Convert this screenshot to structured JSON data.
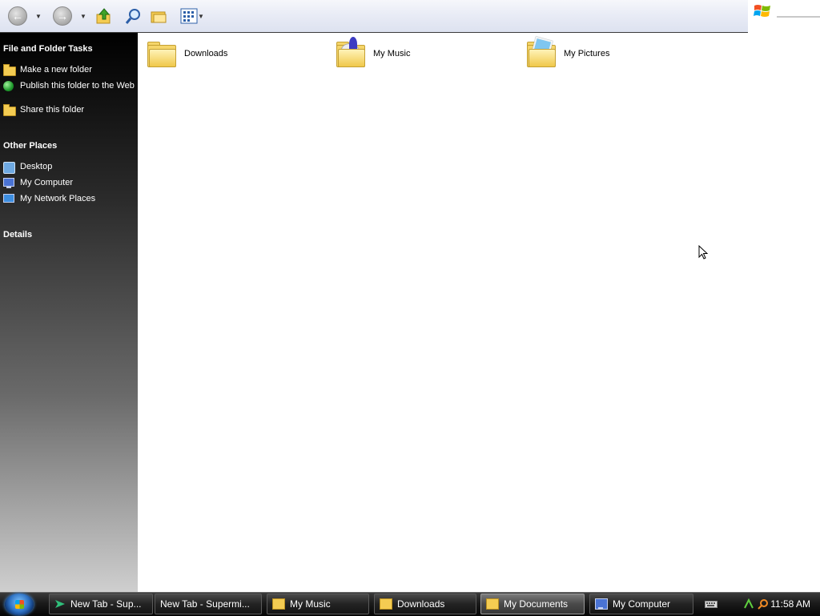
{
  "toolbar": {
    "back_icon": "back-arrow-icon",
    "forward_icon": "forward-arrow-icon",
    "up_icon": "up-folder-icon",
    "search_icon": "search-icon",
    "folders_icon": "folders-icon",
    "views_icon": "views-icon"
  },
  "taskpane": {
    "file_tasks_title": "File and Folder Tasks",
    "file_tasks": [
      {
        "label": "Make a new folder",
        "icon": "new-folder-icon"
      },
      {
        "label": "Publish this folder to the Web",
        "icon": "publish-web-icon"
      },
      {
        "label": "Share this folder",
        "icon": "share-folder-icon"
      }
    ],
    "other_places_title": "Other Places",
    "other_places": [
      {
        "label": "Desktop",
        "icon": "desktop-icon"
      },
      {
        "label": "My Computer",
        "icon": "my-computer-icon"
      },
      {
        "label": "My Network Places",
        "icon": "network-places-icon"
      }
    ],
    "details_title": "Details"
  },
  "content": {
    "items": [
      {
        "label": "Downloads",
        "icon": "folder-icon"
      },
      {
        "label": "My Music",
        "icon": "music-folder-icon"
      },
      {
        "label": "My Pictures",
        "icon": "pictures-folder-icon"
      }
    ]
  },
  "taskbar": {
    "buttons": [
      {
        "label": "New Tab - Sup...",
        "icon": "browser-icon",
        "active": false
      },
      {
        "label": "New Tab - Supermi...",
        "icon": "",
        "active": false
      },
      {
        "label": "My Music",
        "icon": "music-folder-icon",
        "active": false
      },
      {
        "label": "Downloads",
        "icon": "folder-icon",
        "active": false
      },
      {
        "label": "My Documents",
        "icon": "documents-folder-icon",
        "active": true
      },
      {
        "label": "My Computer",
        "icon": "my-computer-icon",
        "active": false
      }
    ],
    "clock": "11:58 AM",
    "tray_icons": [
      "keyboard-icon",
      "network-icon",
      "search-icon"
    ]
  }
}
